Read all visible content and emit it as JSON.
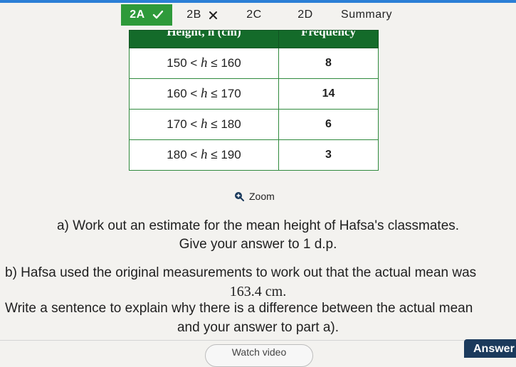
{
  "tabs": [
    {
      "label": "2A",
      "state_icon": "check-icon",
      "active": true,
      "color": "#2e9a3a"
    },
    {
      "label": "2B",
      "state_icon": "cross-icon"
    },
    {
      "label": "2C"
    },
    {
      "label": "2D"
    },
    {
      "label": "Summary"
    }
  ],
  "table": {
    "headers": [
      "Height, h (cm)",
      "Frequency"
    ],
    "header_color": "#146b2a",
    "rows": [
      {
        "lower": "150",
        "upper": "160",
        "frequency": "8"
      },
      {
        "lower": "160",
        "upper": "170",
        "frequency": "14"
      },
      {
        "lower": "170",
        "upper": "180",
        "frequency": "6"
      },
      {
        "lower": "180",
        "upper": "190",
        "frequency": "3"
      }
    ]
  },
  "zoom": {
    "label": "Zoom",
    "icon": "zoom-icon"
  },
  "question": {
    "a_line1": "a) Work out an estimate for the mean height of Hafsa's classmates.",
    "a_line2": "Give your answer to 1 d.p.",
    "b_line1": "b) Hafsa used the original measurements to work out that the actual mean was",
    "b_line2": "163.4 cm.",
    "b_line3": "Write a sentence to explain why there is a difference between the actual mean",
    "b_line4": "and your answer to part a)."
  },
  "buttons": {
    "watch_video": "Watch video",
    "answer": "Answer",
    "answer_color": "#1b3a5c"
  }
}
